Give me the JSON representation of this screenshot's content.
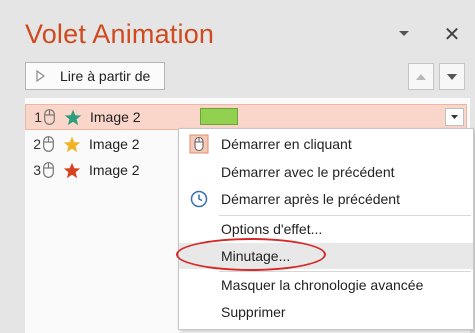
{
  "pane": {
    "title": "Volet Animation",
    "close_glyph": "✕"
  },
  "toolbar": {
    "play_label": "Lire à partir de"
  },
  "animations": [
    {
      "number": "1",
      "name": "Image 2",
      "star_color": "#2e9d7c",
      "selected": true
    },
    {
      "number": "2",
      "name": "Image 2",
      "star_color": "#f0b323",
      "selected": false
    },
    {
      "number": "3",
      "name": "Image 2",
      "star_color": "#d8401f",
      "selected": false
    }
  ],
  "context_menu": {
    "items": [
      {
        "label": "Démarrer en cliquant",
        "icon": "mouse-icon"
      },
      {
        "label": "Démarrer avec le précédent",
        "icon": ""
      },
      {
        "label": "Démarrer après le précédent",
        "icon": "clock-icon"
      },
      {
        "label": "Options d'effet...",
        "icon": ""
      },
      {
        "label": "Minutage...",
        "icon": ""
      },
      {
        "label": "Masquer la chronologie avancée",
        "icon": ""
      },
      {
        "label": "Supprimer",
        "icon": ""
      }
    ],
    "highlighted": "Minutage..."
  },
  "colors": {
    "accent": "#d04a1f",
    "selected_row": "#f9d6c9",
    "timing_bar": "#92d050",
    "annotation": "#d52a2a"
  }
}
